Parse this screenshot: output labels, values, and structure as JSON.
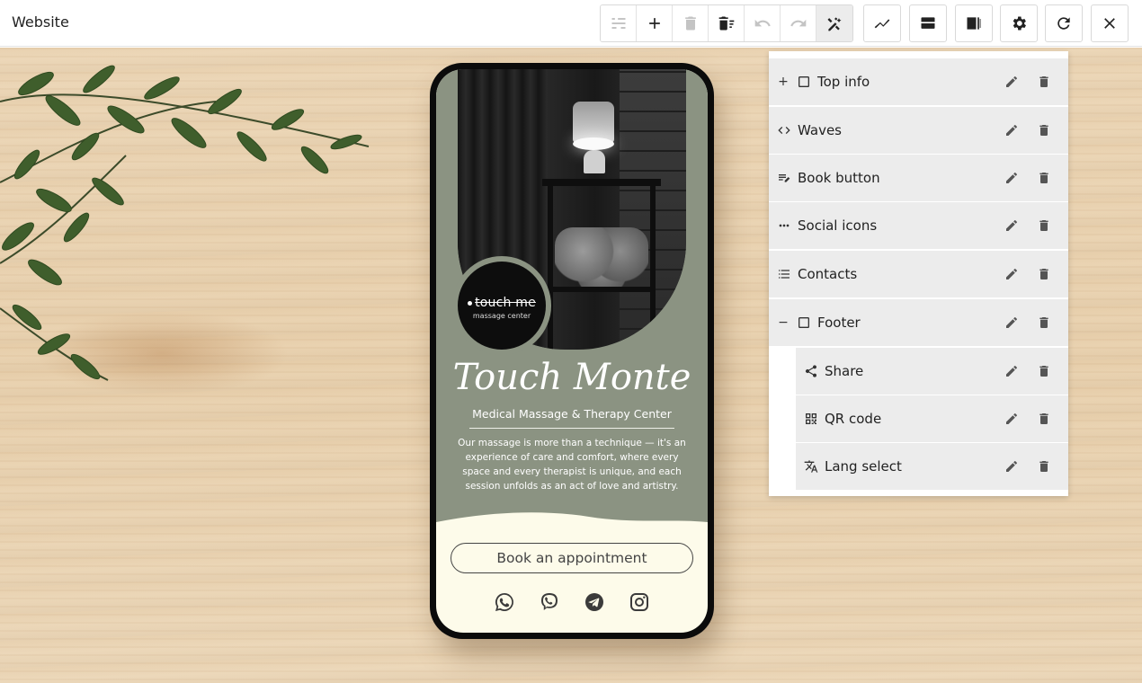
{
  "app": {
    "title": "Website"
  },
  "toolbar": {
    "buttons": [
      {
        "name": "adjust-icon"
      },
      {
        "name": "add-icon"
      },
      {
        "name": "delete-icon"
      },
      {
        "name": "delete-list-icon"
      },
      {
        "name": "undo-icon"
      },
      {
        "name": "redo-icon"
      },
      {
        "name": "design-tools-icon"
      },
      {
        "name": "chart-icon"
      },
      {
        "name": "layout-rows-icon"
      },
      {
        "name": "layout-sidebar-icon"
      },
      {
        "name": "settings-icon"
      },
      {
        "name": "refresh-icon"
      },
      {
        "name": "close-icon"
      }
    ]
  },
  "site": {
    "logo_name": "touch me",
    "logo_sub": "massage center",
    "title": "Touch Monte",
    "subtitle": "Medical Massage & Therapy Center",
    "description": "Our massage is more than a technique — it's an experience of care and comfort, where every space and every therapist is unique, and each session unfolds as an act of love and artistry.",
    "book_label": "Book an appointment",
    "socials": [
      "whatsapp-icon",
      "viber-icon",
      "telegram-icon",
      "instagram-icon"
    ]
  },
  "panel": {
    "items": [
      {
        "label": "Top info",
        "expander": "+",
        "icon": "square-icon"
      },
      {
        "label": "Waves",
        "icon": "code-icon"
      },
      {
        "label": "Book button",
        "icon": "text-edit-icon"
      },
      {
        "label": "Social icons",
        "icon": "more-horiz-icon"
      },
      {
        "label": "Contacts",
        "icon": "list-icon"
      },
      {
        "label": "Footer",
        "expander": "−",
        "icon": "square-icon"
      },
      {
        "label": "Share",
        "icon": "share-icon"
      },
      {
        "label": "QR code",
        "icon": "qr-code-icon"
      },
      {
        "label": "Lang select",
        "icon": "translate-icon"
      }
    ]
  }
}
